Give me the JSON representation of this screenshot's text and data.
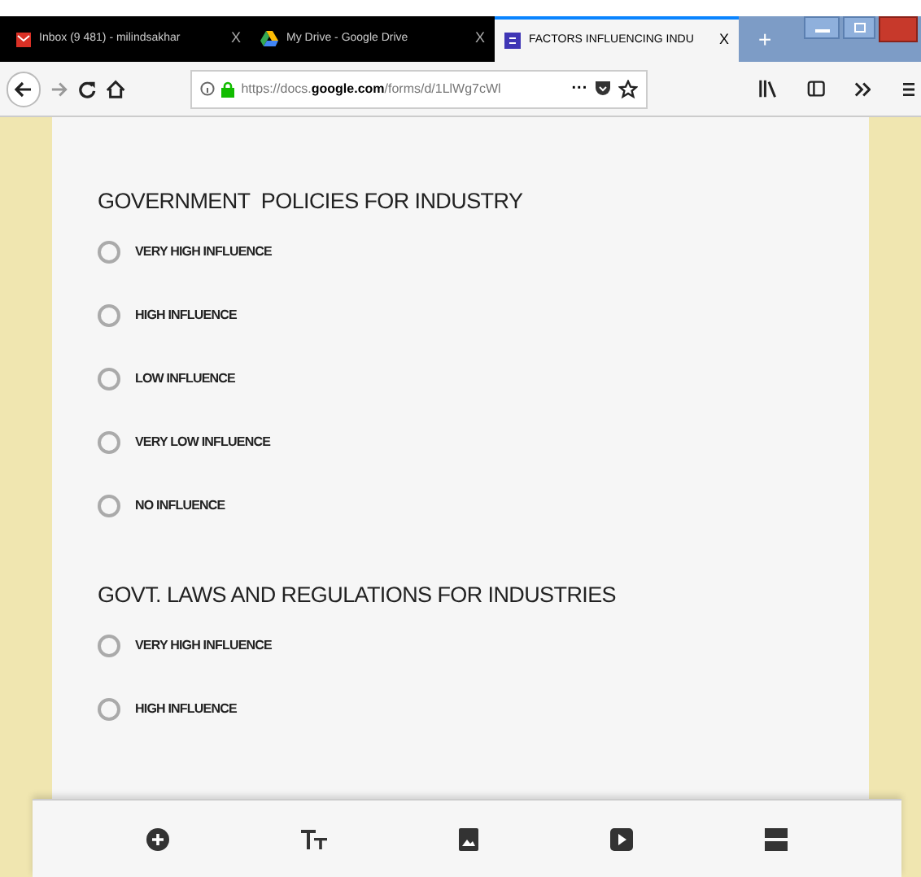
{
  "browser": {
    "tabs": [
      {
        "title": "Inbox (9 481) - milindsakhar",
        "selected": false,
        "close": "X"
      },
      {
        "title": "My Drive - Google Drive",
        "selected": false,
        "close": "X"
      },
      {
        "title": "FACTORS INFLUENCING INDU",
        "selected": true,
        "close": "X"
      }
    ],
    "new_tab": "+",
    "url_prefix": "https://docs.",
    "url_domain": "google.com",
    "url_path": "/forms/d/1LlWg7cWl",
    "more": "···"
  },
  "questions": [
    {
      "title": "GOVERNMENT  POLICIES FOR INDUSTRY",
      "options": [
        {
          "label": "VERY HIGH INFLUENCE",
          "selected": false
        },
        {
          "label": "HIGH INFLUENCE",
          "selected": false
        },
        {
          "label": "LOW INFLUENCE",
          "selected": false
        },
        {
          "label": "VERY LOW INFLUENCE",
          "selected": false
        },
        {
          "label": "NO INFLUENCE",
          "selected": false
        }
      ]
    },
    {
      "title": "GOVT. LAWS AND REGULATIONS FOR INDUSTRIES",
      "options": [
        {
          "label": "VERY HIGH INFLUENCE",
          "selected": false
        },
        {
          "label": "HIGH INFLUENCE",
          "selected": false
        }
      ]
    }
  ],
  "toolbar": [
    {
      "kind": "add"
    },
    {
      "kind": "text"
    },
    {
      "kind": "image"
    },
    {
      "kind": "video"
    },
    {
      "kind": "section"
    }
  ]
}
